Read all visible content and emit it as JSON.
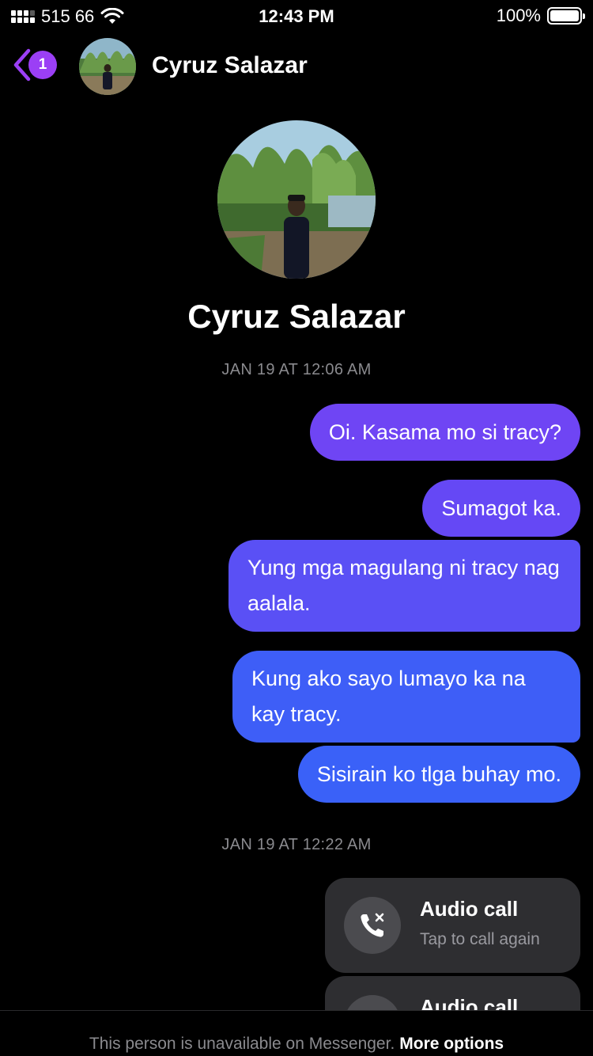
{
  "status_bar": {
    "carrier": "515 66",
    "time": "12:43 PM",
    "battery": "100%"
  },
  "header": {
    "back_badge_count": "1",
    "contact_name": "Cyruz Salazar"
  },
  "profile": {
    "name": "Cyruz Salazar"
  },
  "thread": {
    "timestamp_1": "JAN 19 AT 12:06 AM",
    "messages": [
      {
        "text": "Oi. Kasama mo si tracy?"
      },
      {
        "text": "Sumagot ka."
      },
      {
        "text": "Yung mga magulang ni tracy nag aalala."
      },
      {
        "text": "Kung ako sayo lumayo ka na kay tracy."
      },
      {
        "text": "Sisirain ko tlga buhay mo."
      }
    ],
    "timestamp_2": "JAN 19 AT 12:22 AM",
    "calls": [
      {
        "title": "Audio call",
        "subtitle": "Tap to call again"
      },
      {
        "title": "Audio call"
      }
    ]
  },
  "footer": {
    "unavailable_text": "This person is unavailable on Messenger.",
    "more_options": "More options"
  },
  "colors": {
    "accent": "#9b3ff5",
    "bubble_top": "#6f45f4",
    "bubble_bottom": "#3a61f8"
  }
}
